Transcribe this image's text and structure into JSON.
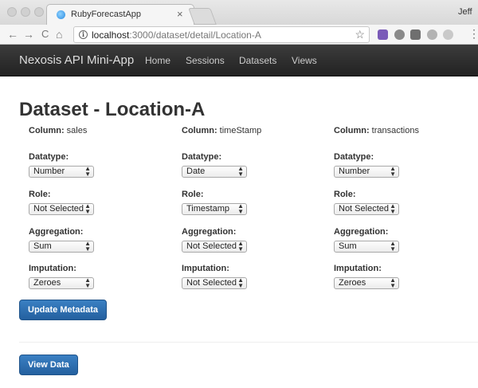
{
  "browser": {
    "tab_title": "RubyForecastApp",
    "tab_close": "×",
    "profile_name": "Jeff",
    "url_host": "localhost",
    "url_path": ":3000/dataset/detail/Location-A",
    "nav": {
      "back": "←",
      "forward": "→",
      "reload": "C",
      "home": "⌂"
    },
    "star": "☆",
    "menu": "⋮",
    "extension_colors": [
      "#7a5ab8",
      "#8a8a8a",
      "#6f6f6f",
      "#b3b3b3",
      "#c9c9c9",
      "#4a7ab5"
    ]
  },
  "navbar": {
    "brand": "Nexosis API Mini-App",
    "links": [
      "Home",
      "Sessions",
      "Datasets",
      "Views"
    ]
  },
  "page": {
    "title": "Dataset - Location-A",
    "column_prefix": "Column:",
    "labels": {
      "datatype": "Datatype:",
      "role": "Role:",
      "aggregation": "Aggregation:",
      "imputation": "Imputation:"
    },
    "columns": [
      {
        "name": "sales",
        "datatype": "Number",
        "role": "Not Selected",
        "aggregation": "Sum",
        "imputation": "Zeroes"
      },
      {
        "name": "timeStamp",
        "datatype": "Date",
        "role": "Timestamp",
        "aggregation": "Not Selected",
        "imputation": "Not Selected"
      },
      {
        "name": "transactions",
        "datatype": "Number",
        "role": "Not Selected",
        "aggregation": "Sum",
        "imputation": "Zeroes"
      }
    ],
    "update_button": "Update Metadata",
    "view_button": "View Data"
  },
  "colors": {
    "primary_button": "#2c6eb0",
    "navbar": "#2b2b2b"
  }
}
